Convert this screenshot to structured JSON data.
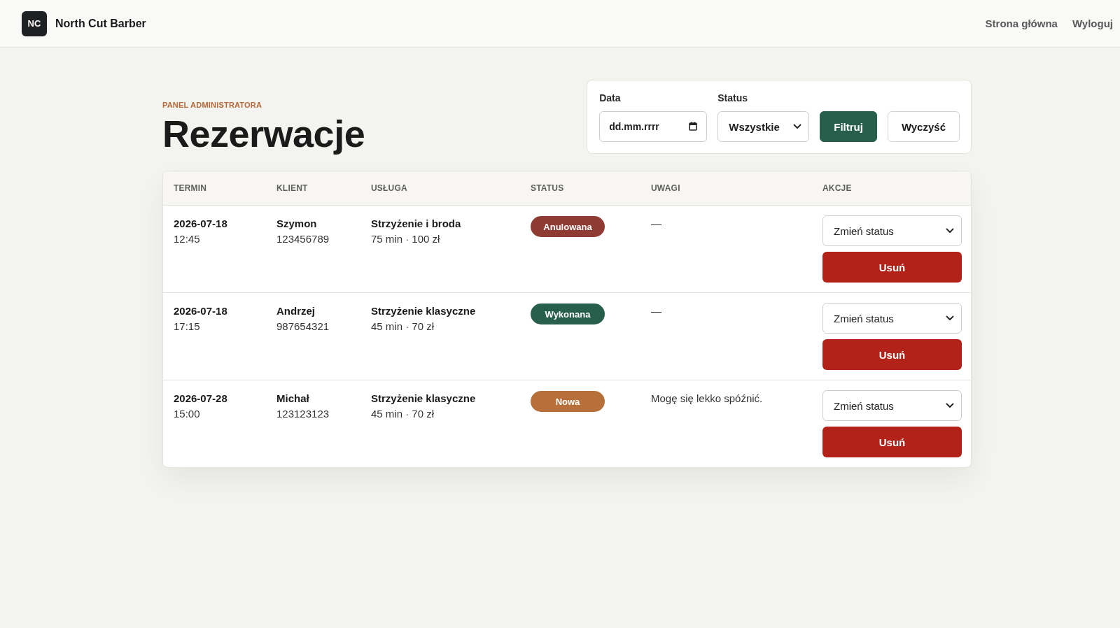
{
  "header": {
    "logo": "NC",
    "brand": "North Cut Barber",
    "nav": [
      "Strona główna",
      "Wyloguj"
    ]
  },
  "page": {
    "eyebrow": "PANEL ADMINISTRATORA",
    "title": "Rezerwacje"
  },
  "filters": {
    "fields": [
      {
        "kind": "date",
        "label": "Data",
        "placeholder": "dd.mm.rrrr"
      },
      {
        "kind": "select",
        "label": "Status",
        "value": "Wszystkie"
      }
    ],
    "buttons": [
      {
        "kind": "primary",
        "label": "Filtruj"
      },
      {
        "kind": "secondary",
        "label": "Wyczyść"
      }
    ]
  },
  "table": {
    "columns": [
      "TERMIN",
      "KLIENT",
      "USŁUGA",
      "STATUS",
      "UWAGI",
      "AKCJE"
    ],
    "rows": [
      {
        "date": "2026-07-18",
        "time": "12:45",
        "client": "Szymon",
        "phone": "123456789",
        "service": "Strzyżenie i broda",
        "details": "75 min · 100 zł",
        "status": {
          "label": "Anulowana",
          "color": "#8f3a32"
        },
        "notes": "—",
        "status_select": "Zmień status",
        "delete_label": "Usuń"
      },
      {
        "date": "2026-07-18",
        "time": "17:15",
        "client": "Andrzej",
        "phone": "987654321",
        "service": "Strzyżenie klasyczne",
        "details": "45 min · 70 zł",
        "status": {
          "label": "Wykonana",
          "color": "#285e4c"
        },
        "notes": "—",
        "status_select": "Zmień status",
        "delete_label": "Usuń"
      },
      {
        "date": "2026-07-28",
        "time": "15:00",
        "client": "Michał",
        "phone": "123123123",
        "service": "Strzyżenie klasyczne",
        "details": "45 min · 70 zł",
        "status": {
          "label": "Nowa",
          "color": "#b8703a"
        },
        "notes": "Mogę się lekko spóźnić.",
        "status_select": "Zmień status",
        "delete_label": "Usuń"
      }
    ]
  }
}
